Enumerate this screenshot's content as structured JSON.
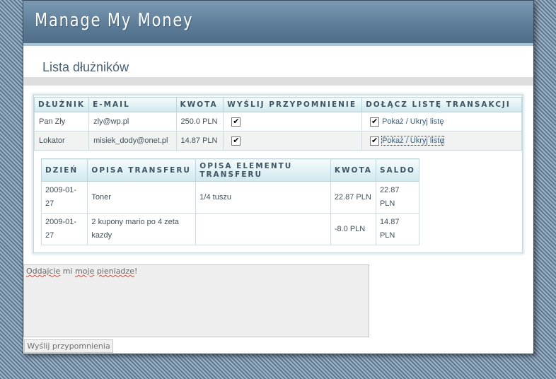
{
  "app": {
    "title": "Manage My Money"
  },
  "page": {
    "title": "Lista dłużników"
  },
  "debtors_table": {
    "headers": [
      "DŁUŻNIK",
      "E-MAIL",
      "KWOTA",
      "WYŚLIJ PRZYPOMNIENIE",
      "DOŁĄCZ LISTĘ TRANSAKCJI"
    ],
    "rows": [
      {
        "name": "Pan Zły",
        "email": "zly@wp.pl",
        "amount": "250.0 PLN",
        "remind_checked": true,
        "attach_checked": true,
        "toggle_label": "Pokaż / Ukryj listę"
      },
      {
        "name": "Lokator",
        "email": "misiek_dody@onet.pl",
        "amount": "14.87 PLN",
        "remind_checked": true,
        "attach_checked": true,
        "toggle_label": "Pokaż / Ukryj listę"
      }
    ]
  },
  "transactions_table": {
    "headers": [
      "DZIEŃ",
      "OPISA TRANSFERU",
      "OPISA ELEMENTU TRANSFERU",
      "KWOTA",
      "SALDO"
    ],
    "rows": [
      {
        "day": "2009-01-27",
        "transfer": "Toner",
        "element": "1/4 tuszu",
        "amount": "22.87 PLN",
        "balance": "22.87 PLN"
      },
      {
        "day": "2009-01-27",
        "transfer": "2 kupony mario po 4 zeta kazdy",
        "element": "",
        "amount": "-8.0 PLN",
        "balance": "14.87 PLN"
      }
    ]
  },
  "message": {
    "words": [
      "Oddajcie",
      "mi",
      "moje",
      "pieniadze",
      "!"
    ]
  },
  "send_button": {
    "label": "Wyślij przypomnienia"
  }
}
